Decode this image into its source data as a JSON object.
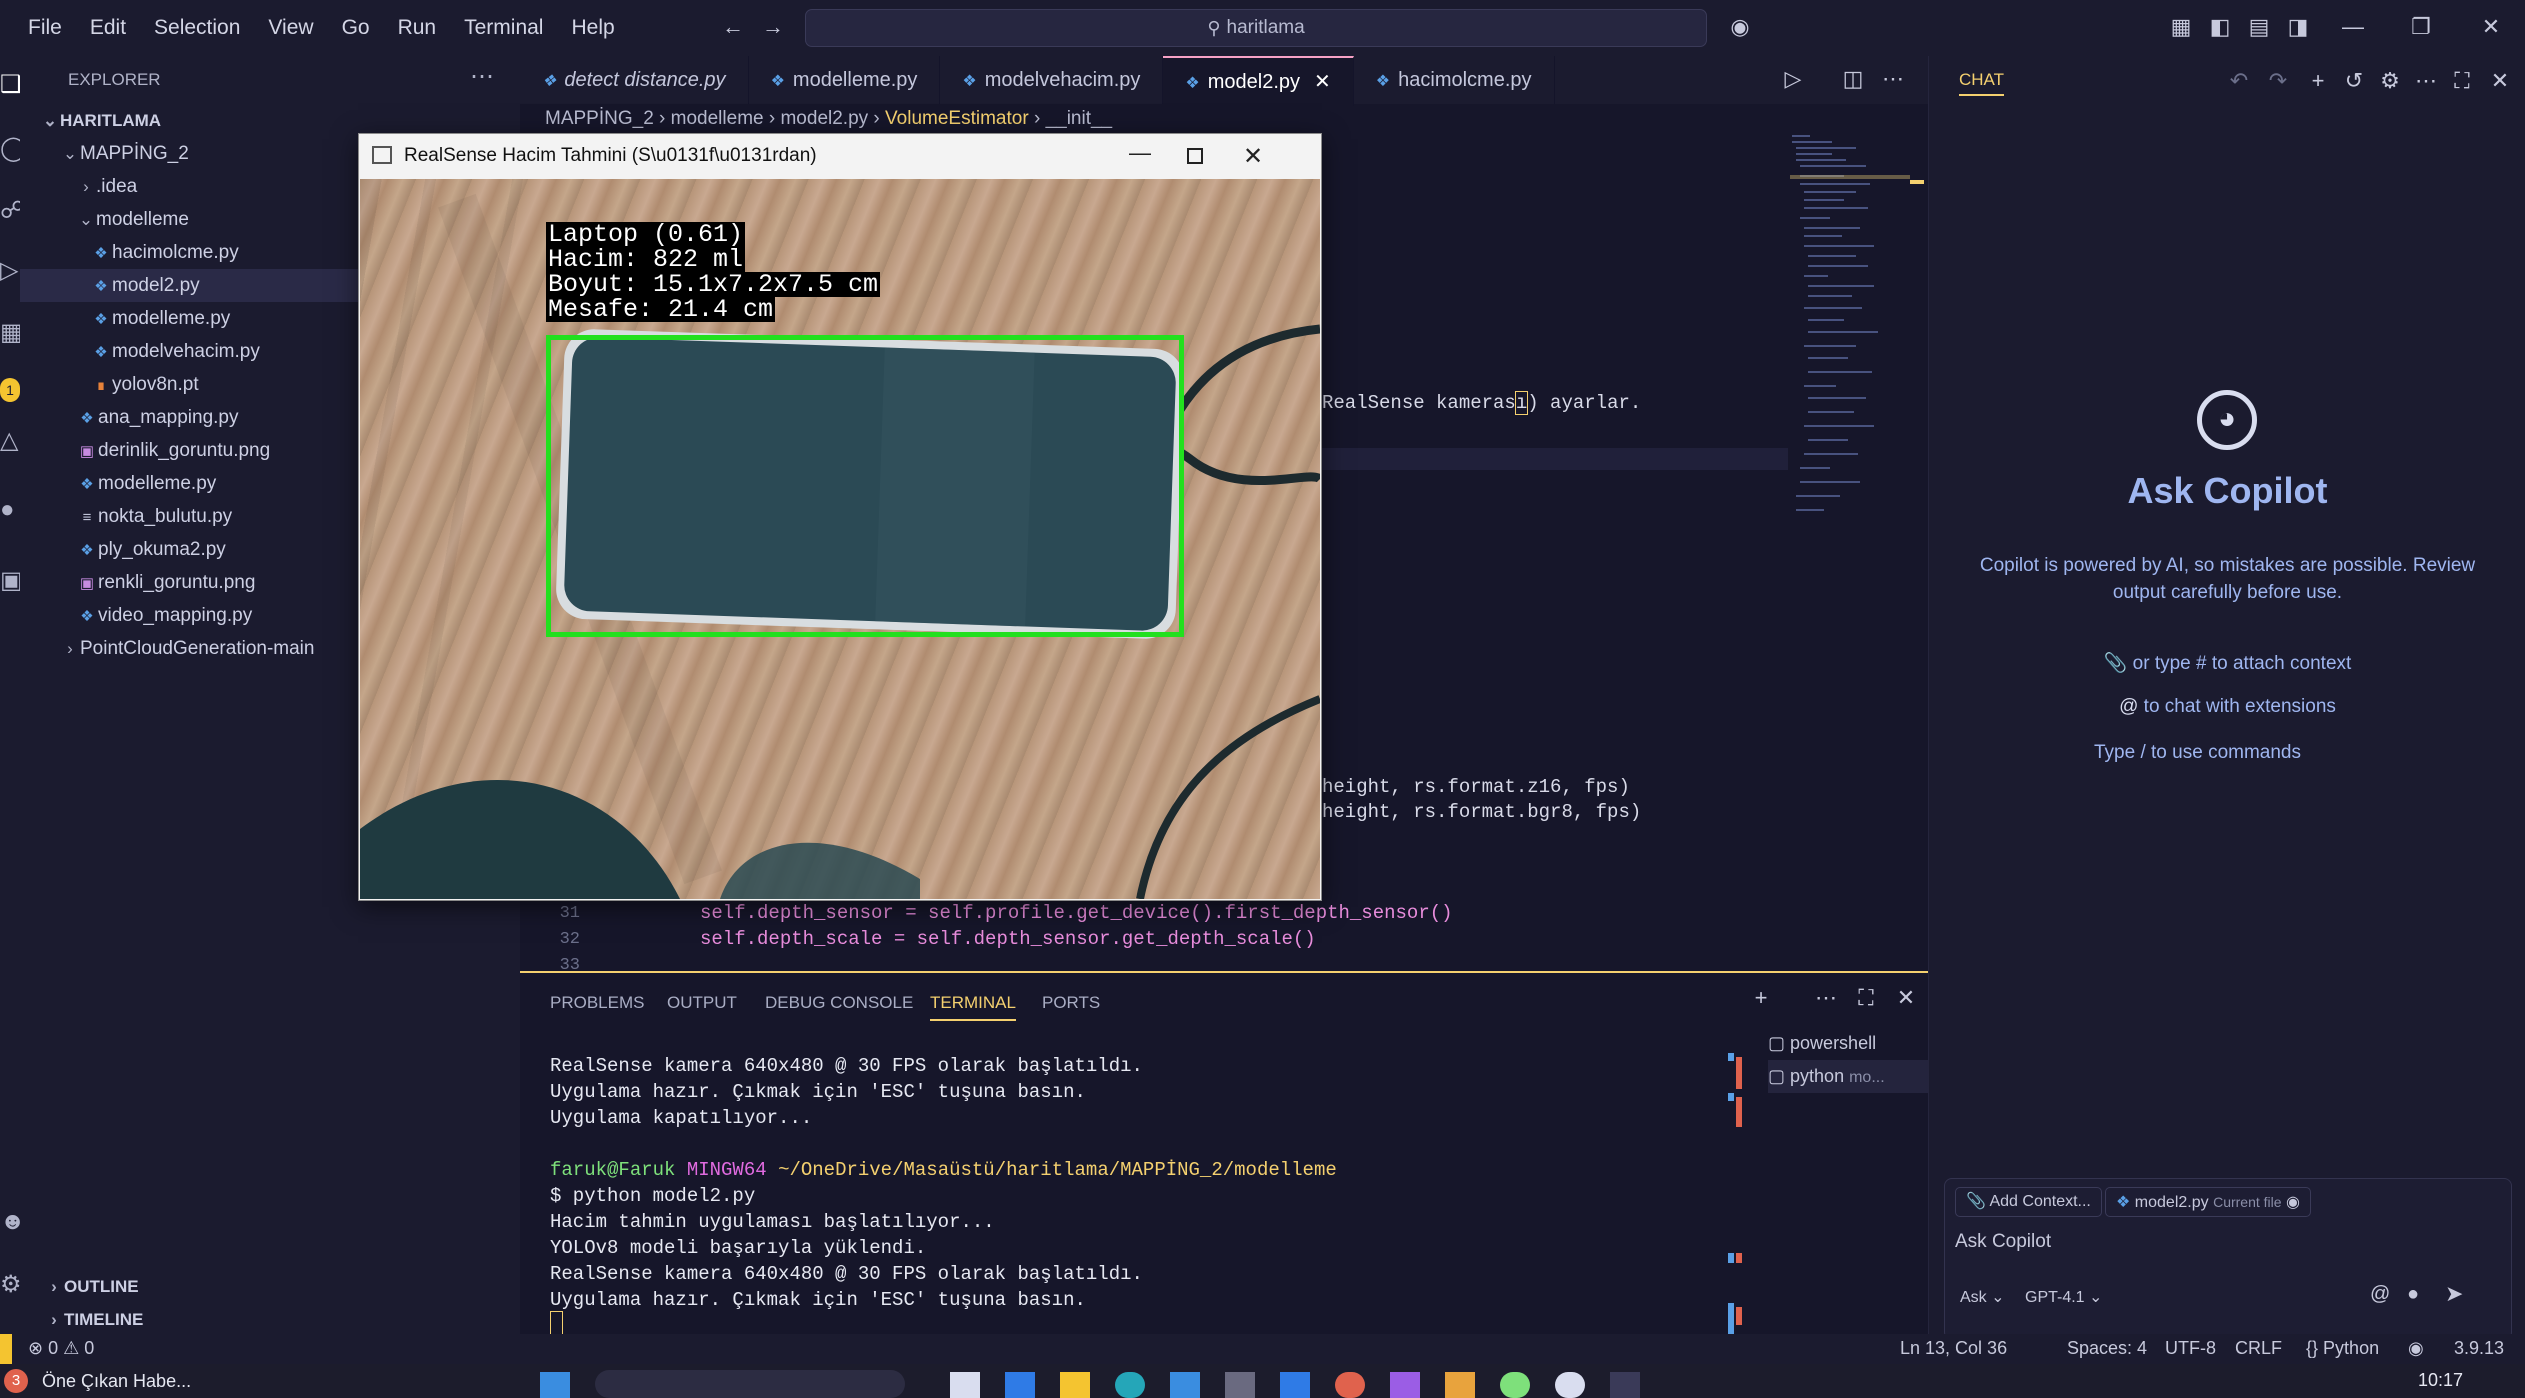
{
  "titlebar": {
    "menu": [
      "File",
      "Edit",
      "Selection",
      "View",
      "Go",
      "Run",
      "Terminal",
      "Help"
    ],
    "search": "haritlama"
  },
  "explorer": {
    "header": "EXPLORER",
    "root": "HARITLAMA",
    "items": [
      {
        "label": "MAPPİNG_2"
      },
      {
        "label": ".idea"
      },
      {
        "label": "modelleme"
      },
      {
        "label": "hacimolcme.py"
      },
      {
        "label": "model2.py"
      },
      {
        "label": "modelleme.py"
      },
      {
        "label": "modelvehacim.py"
      },
      {
        "label": "yolov8n.pt"
      },
      {
        "label": "ana_mapping.py"
      },
      {
        "label": "derinlik_goruntu.png"
      },
      {
        "label": "modelleme.py"
      },
      {
        "label": "nokta_bulutu.py"
      },
      {
        "label": "ply_okuma2.py"
      },
      {
        "label": "renkli_goruntu.png"
      },
      {
        "label": "video_mapping.py"
      },
      {
        "label": "PointCloudGeneration-main"
      }
    ],
    "outline": "OUTLINE",
    "timeline": "TIMELINE",
    "badge": "1"
  },
  "tabs": [
    {
      "label": "detect distance.py"
    },
    {
      "label": "modelleme.py"
    },
    {
      "label": "modelvehacim.py"
    },
    {
      "label": "model2.py"
    },
    {
      "label": "hacimolcme.py"
    }
  ],
  "breadcrumb": [
    "MAPPİNG_2",
    "modelleme",
    "model2.py",
    "VolumeEstimator",
    "__init__"
  ],
  "code": {
    "visible_fragment_1": "RealSense kameras",
    "visible_fragment_1_tail": "ı",
    "visible_fragment_1_end": ") ayarlar.",
    "visible_fragment_2": "height, rs.format.z16, fps)",
    "visible_fragment_3": "height, rs.format.bgr8, fps)",
    "line31_num": "31",
    "line31": "self.depth_sensor = self.profile.get_device().first_depth_sensor()",
    "line32_num": "32",
    "line32": "self.depth_scale = self.depth_sensor.get_depth_scale()",
    "line33_num": "33"
  },
  "panel": {
    "tabs": [
      "PROBLEMS",
      "OUTPUT",
      "DEBUG CONSOLE",
      "TERMINAL",
      "PORTS"
    ],
    "terminal_lines": [
      "RealSense kamera 640x480 @ 30 FPS olarak başlatıldı.",
      "Uygulama hazır. Çıkmak için 'ESC' tuşuna basın.",
      "Uygulama kapatılıyor..."
    ],
    "prompt_user": "faruk@Faruk",
    "prompt_env": "MINGW64",
    "prompt_path": "~/OneDrive/Masaüstü/haritlama/MAPPİNG_2/modelleme",
    "command": "$ python model2.py",
    "output_lines": [
      "Hacim tahmin uygulaması başlatılıyor...",
      "YOLOv8 modeli başarıyla yüklendi.",
      "RealSense kamera 640x480 @ 30 FPS olarak başlatıldı.",
      "Uygulama hazır. Çıkmak için 'ESC' tuşuna basın."
    ],
    "shells": [
      "powershell",
      "python",
      "mo..."
    ]
  },
  "chat": {
    "title": "CHAT",
    "heading": "Ask Copilot",
    "disclaimer": "Copilot is powered by AI, so mistakes are possible. Review output carefully before use.",
    "hint1": "or type # to attach context",
    "hint2": "to chat with extensions",
    "hint3": "Type / to use commands",
    "add_context": "Add Context...",
    "current_file": "model2.py",
    "current_file_note": "Current file",
    "input_placeholder": "Ask Copilot",
    "mode": "Ask",
    "model": "GPT-4.1"
  },
  "statusbar": {
    "errors": "0",
    "warnings": "0",
    "position": "Ln 13, Col 36",
    "spaces": "Spaces: 4",
    "encoding": "UTF-8",
    "eol": "CRLF",
    "language": "Python",
    "version": "3.9.13"
  },
  "taskbar": {
    "news": "Öne Çıkan Habe...",
    "news_badge": "3",
    "clock": "10:17"
  },
  "rs_window": {
    "title": "RealSense Hacim Tahmini (S\\u0131f\\u0131rdan)",
    "labels": [
      "Laptop (0.61)",
      "Hacim: 822 ml",
      "Boyut: 15.1x7.2x7.5 cm",
      "Mesafe: 21.4 cm"
    ],
    "bbox_color": "#22e01e"
  },
  "colors": {
    "accent": "#f4d06f",
    "tab_active_border": "#f6a1c5",
    "python_icon": "#5aa0e6"
  }
}
